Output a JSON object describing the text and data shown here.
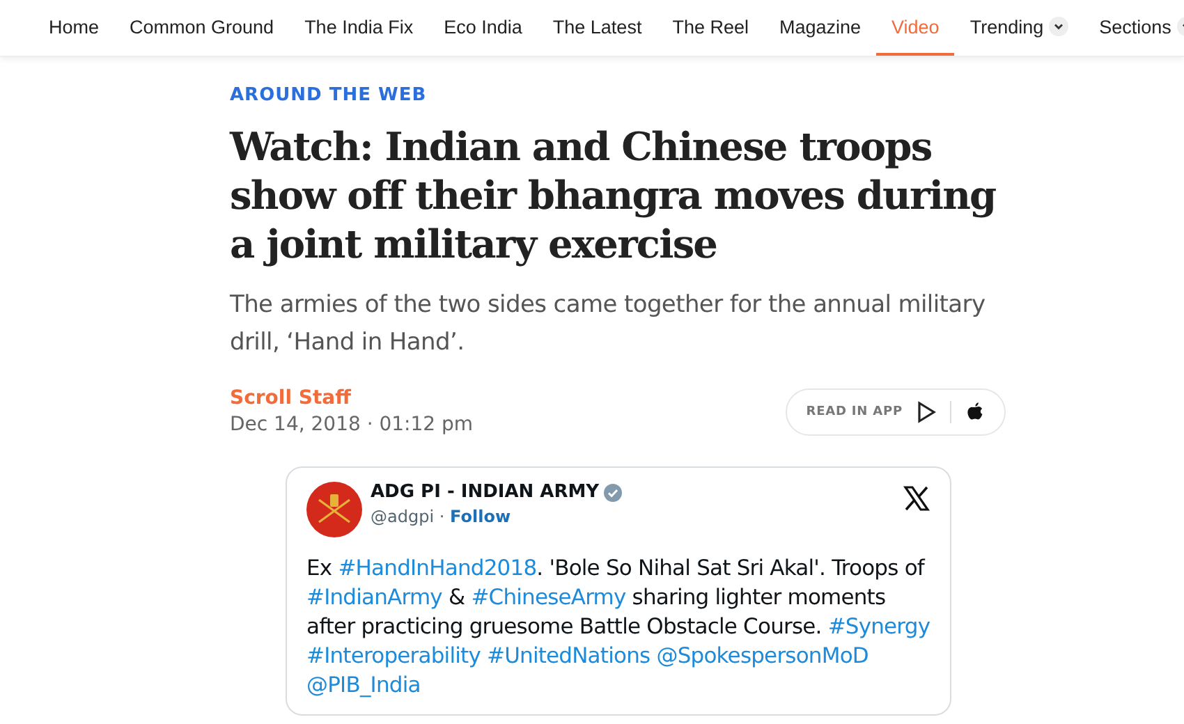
{
  "nav": [
    {
      "label": "Home",
      "selected": false,
      "has_menu": false
    },
    {
      "label": "Common Ground",
      "selected": false,
      "has_menu": false
    },
    {
      "label": "The India Fix",
      "selected": false,
      "has_menu": false
    },
    {
      "label": "Eco India",
      "selected": false,
      "has_menu": false
    },
    {
      "label": "The Latest",
      "selected": false,
      "has_menu": false
    },
    {
      "label": "The Reel",
      "selected": false,
      "has_menu": false
    },
    {
      "label": "Magazine",
      "selected": false,
      "has_menu": false
    },
    {
      "label": "Video",
      "selected": true,
      "has_menu": false
    },
    {
      "label": "Trending",
      "selected": false,
      "has_menu": true
    },
    {
      "label": "Sections",
      "selected": false,
      "has_menu": true
    }
  ],
  "article": {
    "category": "AROUND THE WEB",
    "headline": "Watch: Indian and Chinese troops show off their bhangra moves during a joint military exercise",
    "standfirst": "The armies of the two sides came together for the annual military drill, ‘Hand in Hand’.",
    "author": "Scroll Staff",
    "date": "Dec 14, 2018 · 01:12 pm",
    "app_button": "READ IN APP"
  },
  "tweet": {
    "name": "ADG PI - INDIAN ARMY",
    "verified": true,
    "handle": "@adgpi",
    "separator": "·",
    "follow": "Follow",
    "text": [
      {
        "kind": "text",
        "text": "Ex "
      },
      {
        "kind": "link",
        "text": "#HandInHand2018"
      },
      {
        "kind": "text",
        "text": ". 'Bole So Nihal Sat Sri Akal'. Troops of "
      },
      {
        "kind": "link",
        "text": "#IndianArmy"
      },
      {
        "kind": "text",
        "text": " & "
      },
      {
        "kind": "link",
        "text": "#ChineseArmy"
      },
      {
        "kind": "text",
        "text": " sharing lighter moments after practicing gruesome Battle Obstacle Course. "
      },
      {
        "kind": "link",
        "text": "#Synergy"
      },
      {
        "kind": "link",
        "text": "#Interoperability"
      },
      {
        "kind": "link",
        "text": "#UnitedNations"
      },
      {
        "kind": "link",
        "text": "@SpokespersonMoD"
      },
      {
        "kind": "link",
        "text": "@PIB_India"
      }
    ]
  }
}
